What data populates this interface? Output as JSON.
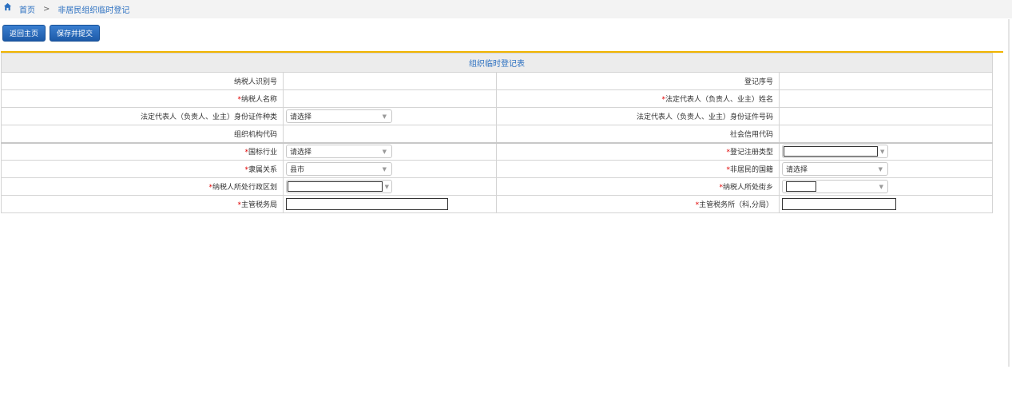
{
  "breadcrumb": {
    "home": "首页",
    "separator": ">",
    "current": "非居民组织临时登记"
  },
  "toolbar": {
    "back_label": "返回主页",
    "save_label": "保存并提交"
  },
  "form": {
    "title": "组织临时登记表",
    "required_mark": "*",
    "rows": [
      {
        "left_label": "纳税人识别号",
        "right_label": "登记序号"
      },
      {
        "left_label": "纳税人名称",
        "right_label": "法定代表人（负责人、业主）姓名"
      },
      {
        "left_label": "法定代表人（负责人、业主）身份证件种类",
        "left_value": "请选择",
        "right_label": "法定代表人（负责人、业主）身份证件号码"
      },
      {
        "left_label": "组织机构代码",
        "right_label": "社会信用代码"
      },
      {
        "left_label": "国标行业",
        "left_value": "请选择",
        "right_label": "登记注册类型"
      },
      {
        "left_label": "隶属关系",
        "left_value": "县市",
        "right_label": "非居民的国籍",
        "right_value": "请选择"
      },
      {
        "left_label": "纳税人所处行政区划",
        "right_label": "纳税人所处街乡"
      },
      {
        "left_label": "主管税务局",
        "right_label": "主管税务所（科,分局）"
      }
    ]
  }
}
